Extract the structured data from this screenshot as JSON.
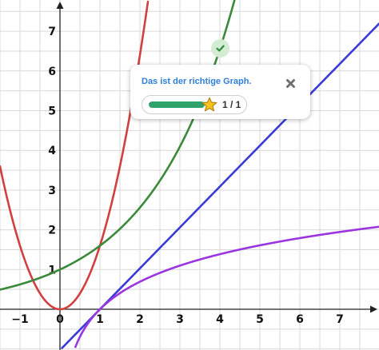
{
  "graph": {
    "x_ticks": [
      "−1",
      "0",
      "1",
      "2",
      "3",
      "4",
      "5",
      "6",
      "7"
    ],
    "y_ticks": [
      "1",
      "2",
      "3",
      "4",
      "5",
      "6",
      "7"
    ],
    "x_range": [
      -1.5,
      8.0
    ],
    "y_range": [
      -0.95,
      7.6
    ],
    "curves": [
      {
        "id": "red-parabola",
        "color": "#d13f3f"
      },
      {
        "id": "green-exponential",
        "color": "#3a8a3a"
      },
      {
        "id": "blue-line",
        "color": "#3a3ad8"
      },
      {
        "id": "purple-log",
        "color": "#9b35e0"
      }
    ]
  },
  "feedback": {
    "message": "Das ist der richtige Graph.",
    "progress_text": "1 / 1",
    "progress_fraction": 1.0,
    "progress_color": "#2fa36b",
    "check_color": "#2e8b3a",
    "close_icon": "close-icon",
    "star_icon": "star-icon",
    "check_icon": "check-icon"
  }
}
